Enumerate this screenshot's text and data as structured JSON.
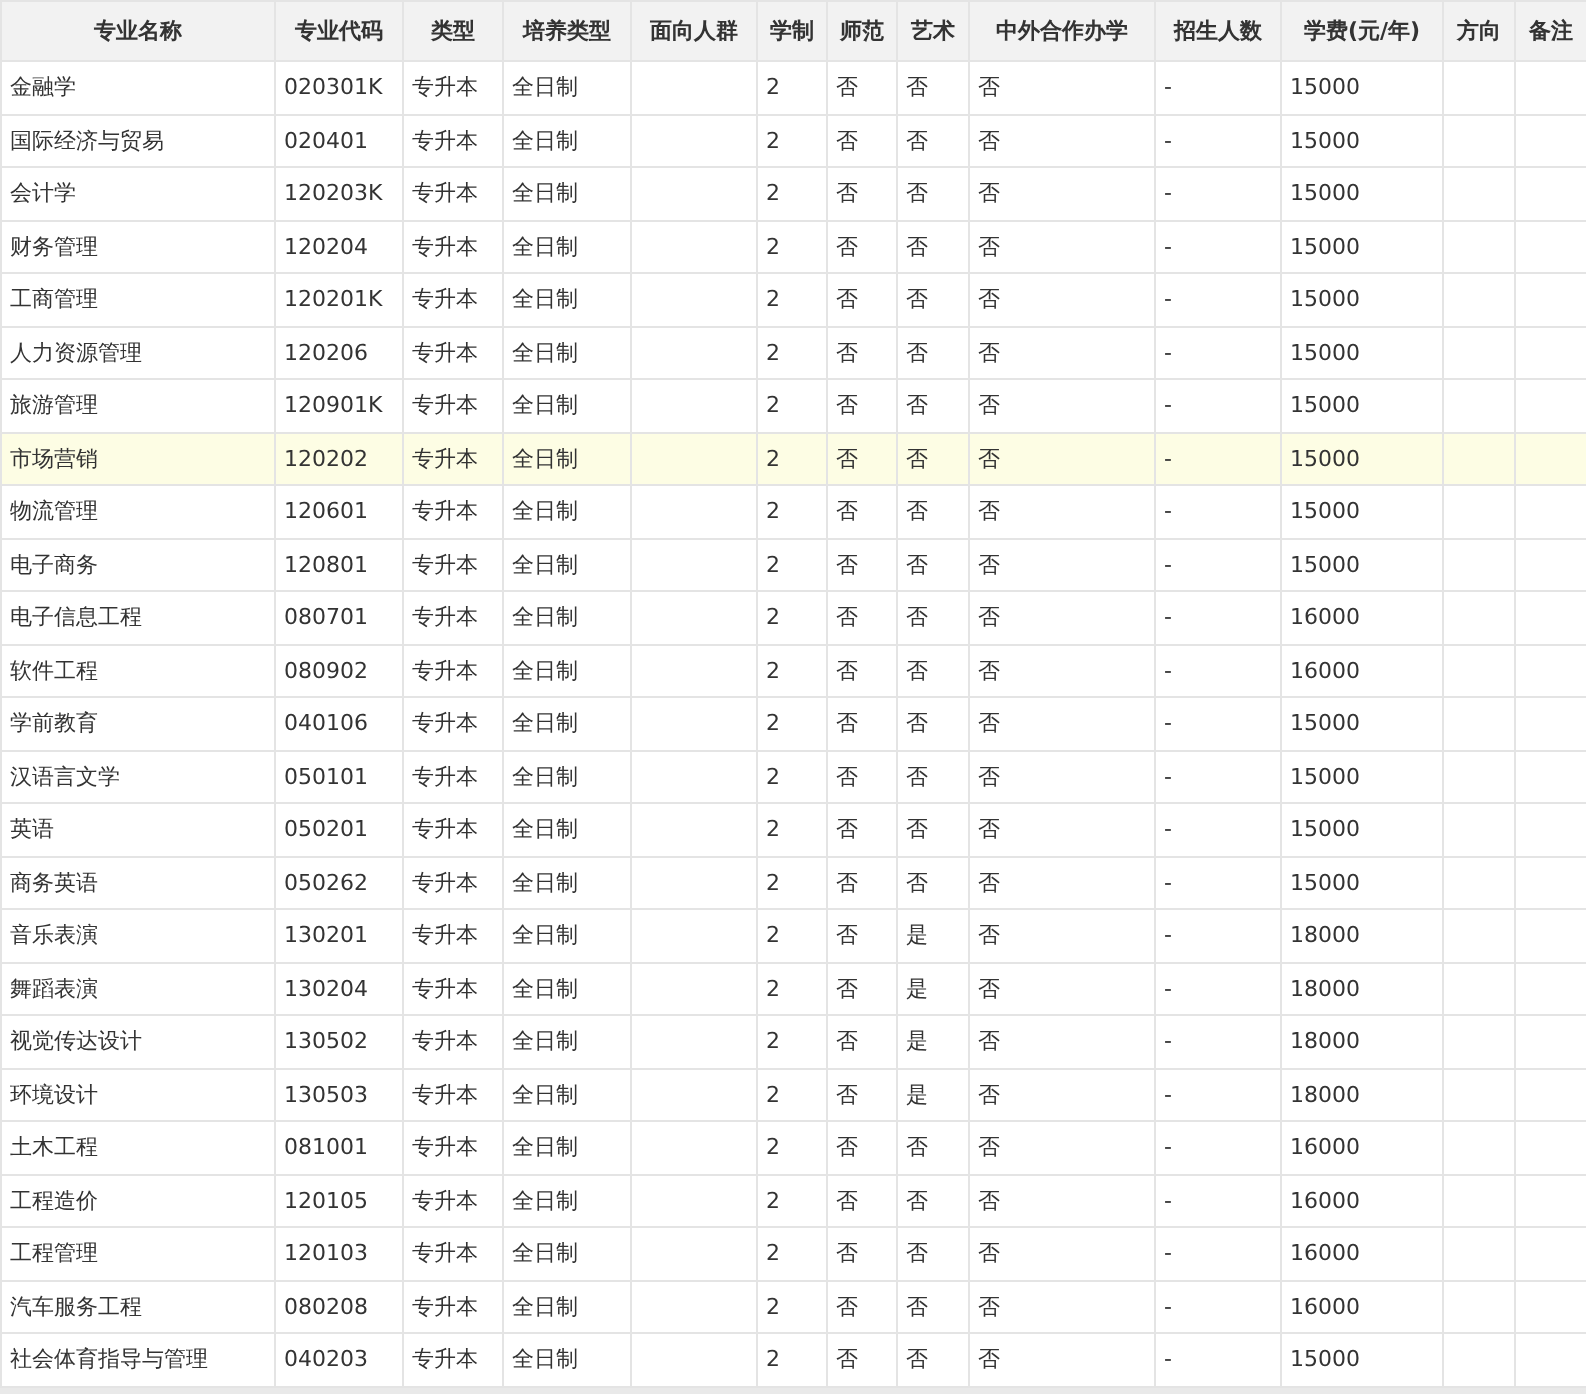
{
  "table": {
    "columns": [
      "专业名称",
      "专业代码",
      "类型",
      "培养类型",
      "面向人群",
      "学制",
      "师范",
      "艺术",
      "中外合作办学",
      "招生人数",
      "学费(元/年)",
      "方向",
      "备注"
    ],
    "rows": [
      {
        "name": "金融学",
        "code": "020301K",
        "type": "专升本",
        "mode": "全日制",
        "years": "2",
        "teacher": "否",
        "art": "否",
        "joint": "否",
        "enrollment": "-",
        "tuition": "15000",
        "selected": false
      },
      {
        "name": "国际经济与贸易",
        "code": "020401",
        "type": "专升本",
        "mode": "全日制",
        "years": "2",
        "teacher": "否",
        "art": "否",
        "joint": "否",
        "enrollment": "-",
        "tuition": "15000",
        "selected": false
      },
      {
        "name": "会计学",
        "code": "120203K",
        "type": "专升本",
        "mode": "全日制",
        "years": "2",
        "teacher": "否",
        "art": "否",
        "joint": "否",
        "enrollment": "-",
        "tuition": "15000",
        "selected": false
      },
      {
        "name": "财务管理",
        "code": "120204",
        "type": "专升本",
        "mode": "全日制",
        "years": "2",
        "teacher": "否",
        "art": "否",
        "joint": "否",
        "enrollment": "-",
        "tuition": "15000",
        "selected": false
      },
      {
        "name": "工商管理",
        "code": "120201K",
        "type": "专升本",
        "mode": "全日制",
        "years": "2",
        "teacher": "否",
        "art": "否",
        "joint": "否",
        "enrollment": "-",
        "tuition": "15000",
        "selected": false
      },
      {
        "name": "人力资源管理",
        "code": "120206",
        "type": "专升本",
        "mode": "全日制",
        "years": "2",
        "teacher": "否",
        "art": "否",
        "joint": "否",
        "enrollment": "-",
        "tuition": "15000",
        "selected": false
      },
      {
        "name": "旅游管理",
        "code": "120901K",
        "type": "专升本",
        "mode": "全日制",
        "years": "2",
        "teacher": "否",
        "art": "否",
        "joint": "否",
        "enrollment": "-",
        "tuition": "15000",
        "selected": false
      },
      {
        "name": "市场营销",
        "code": "120202",
        "type": "专升本",
        "mode": "全日制",
        "years": "2",
        "teacher": "否",
        "art": "否",
        "joint": "否",
        "enrollment": "-",
        "tuition": "15000",
        "selected": true
      },
      {
        "name": "物流管理",
        "code": "120601",
        "type": "专升本",
        "mode": "全日制",
        "years": "2",
        "teacher": "否",
        "art": "否",
        "joint": "否",
        "enrollment": "-",
        "tuition": "15000",
        "selected": false
      },
      {
        "name": "电子商务",
        "code": "120801",
        "type": "专升本",
        "mode": "全日制",
        "years": "2",
        "teacher": "否",
        "art": "否",
        "joint": "否",
        "enrollment": "-",
        "tuition": "15000",
        "selected": false
      },
      {
        "name": "电子信息工程",
        "code": "080701",
        "type": "专升本",
        "mode": "全日制",
        "years": "2",
        "teacher": "否",
        "art": "否",
        "joint": "否",
        "enrollment": "-",
        "tuition": "16000",
        "selected": false
      },
      {
        "name": "软件工程",
        "code": "080902",
        "type": "专升本",
        "mode": "全日制",
        "years": "2",
        "teacher": "否",
        "art": "否",
        "joint": "否",
        "enrollment": "-",
        "tuition": "16000",
        "selected": false
      },
      {
        "name": "学前教育",
        "code": "040106",
        "type": "专升本",
        "mode": "全日制",
        "years": "2",
        "teacher": "否",
        "art": "否",
        "joint": "否",
        "enrollment": "-",
        "tuition": "15000",
        "selected": false
      },
      {
        "name": "汉语言文学",
        "code": "050101",
        "type": "专升本",
        "mode": "全日制",
        "years": "2",
        "teacher": "否",
        "art": "否",
        "joint": "否",
        "enrollment": "-",
        "tuition": "15000",
        "selected": false
      },
      {
        "name": "英语",
        "code": "050201",
        "type": "专升本",
        "mode": "全日制",
        "years": "2",
        "teacher": "否",
        "art": "否",
        "joint": "否",
        "enrollment": "-",
        "tuition": "15000",
        "selected": false
      },
      {
        "name": "商务英语",
        "code": "050262",
        "type": "专升本",
        "mode": "全日制",
        "years": "2",
        "teacher": "否",
        "art": "否",
        "joint": "否",
        "enrollment": "-",
        "tuition": "15000",
        "selected": false
      },
      {
        "name": "音乐表演",
        "code": "130201",
        "type": "专升本",
        "mode": "全日制",
        "years": "2",
        "teacher": "否",
        "art": "是",
        "joint": "否",
        "enrollment": "-",
        "tuition": "18000",
        "selected": false
      },
      {
        "name": "舞蹈表演",
        "code": "130204",
        "type": "专升本",
        "mode": "全日制",
        "years": "2",
        "teacher": "否",
        "art": "是",
        "joint": "否",
        "enrollment": "-",
        "tuition": "18000",
        "selected": false
      },
      {
        "name": "视觉传达设计",
        "code": "130502",
        "type": "专升本",
        "mode": "全日制",
        "years": "2",
        "teacher": "否",
        "art": "是",
        "joint": "否",
        "enrollment": "-",
        "tuition": "18000",
        "selected": false
      },
      {
        "name": "环境设计",
        "code": "130503",
        "type": "专升本",
        "mode": "全日制",
        "years": "2",
        "teacher": "否",
        "art": "是",
        "joint": "否",
        "enrollment": "-",
        "tuition": "18000",
        "selected": false
      },
      {
        "name": "土木工程",
        "code": "081001",
        "type": "专升本",
        "mode": "全日制",
        "years": "2",
        "teacher": "否",
        "art": "否",
        "joint": "否",
        "enrollment": "-",
        "tuition": "16000",
        "selected": false
      },
      {
        "name": "工程造价",
        "code": "120105",
        "type": "专升本",
        "mode": "全日制",
        "years": "2",
        "teacher": "否",
        "art": "否",
        "joint": "否",
        "enrollment": "-",
        "tuition": "16000",
        "selected": false
      },
      {
        "name": "工程管理",
        "code": "120103",
        "type": "专升本",
        "mode": "全日制",
        "years": "2",
        "teacher": "否",
        "art": "否",
        "joint": "否",
        "enrollment": "-",
        "tuition": "16000",
        "selected": false
      },
      {
        "name": "汽车服务工程",
        "code": "080208",
        "type": "专升本",
        "mode": "全日制",
        "years": "2",
        "teacher": "否",
        "art": "否",
        "joint": "否",
        "enrollment": "-",
        "tuition": "16000",
        "selected": false
      },
      {
        "name": "社会体育指导与管理",
        "code": "040203",
        "type": "专升本",
        "mode": "全日制",
        "years": "2",
        "teacher": "否",
        "art": "否",
        "joint": "否",
        "enrollment": "-",
        "tuition": "15000",
        "selected": false
      }
    ]
  }
}
